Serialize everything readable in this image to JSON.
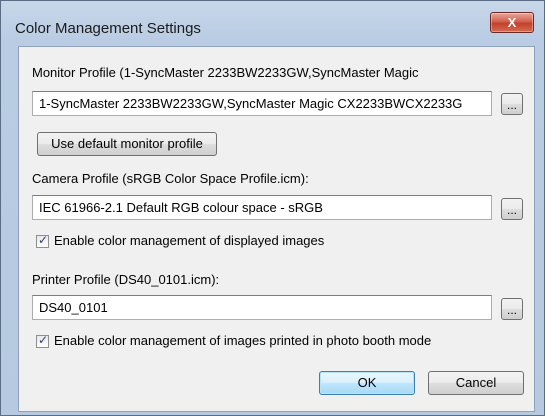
{
  "window": {
    "title": "Color Management Settings",
    "close_glyph": "X"
  },
  "monitor": {
    "label": "Monitor Profile (1-SyncMaster 2233BW2233GW,SyncMaster Magic",
    "value": "1-SyncMaster 2233BW2233GW,SyncMaster Magic CX2233BWCX2233G",
    "browse_label": "...",
    "default_button_label": "Use default monitor profile"
  },
  "camera": {
    "label": "Camera Profile (sRGB Color Space Profile.icm):",
    "value": "IEC 61966-2.1 Default RGB colour space - sRGB",
    "browse_label": "...",
    "checkbox_label": "Enable color management of displayed images",
    "checkbox_checked": true
  },
  "printer": {
    "label": "Printer Profile (DS40_0101.icm):",
    "value": "DS40_0101",
    "browse_label": "...",
    "checkbox_label": "Enable color management of images printed in photo booth mode",
    "checkbox_checked": true
  },
  "buttons": {
    "ok_label": "OK",
    "cancel_label": "Cancel"
  },
  "colors": {
    "frame": "#b9cce3",
    "client": "#f0f0f0",
    "close_button": "#c2402b",
    "ok_button": "#bee6fd"
  }
}
